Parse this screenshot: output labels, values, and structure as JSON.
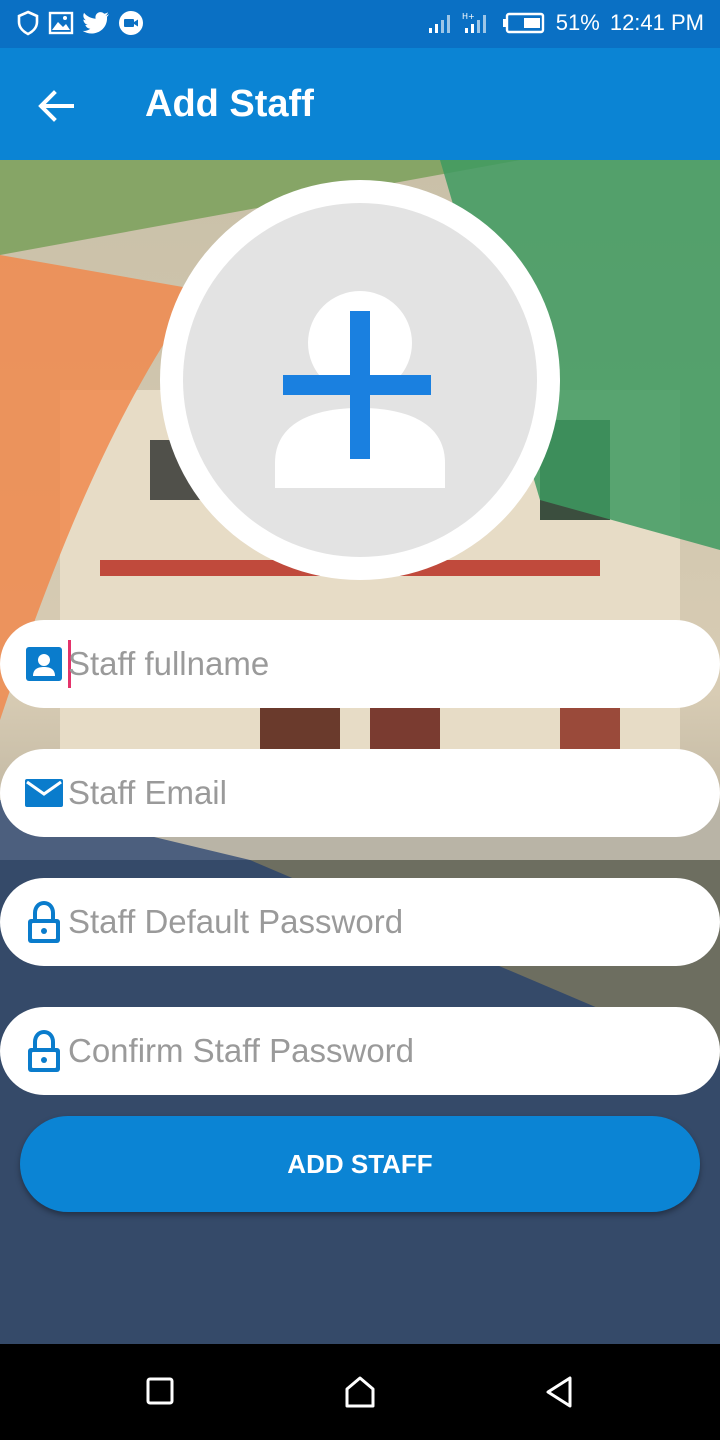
{
  "status_bar": {
    "battery": "51%",
    "time": "12:41 PM",
    "left_icons": [
      "shield-icon",
      "image-icon",
      "twitter-icon",
      "video-icon"
    ],
    "right_icons": [
      "signal-icon",
      "signal-ht-icon",
      "battery-icon"
    ]
  },
  "app_bar": {
    "title": "Add Staff",
    "back_icon": "arrow-left-icon"
  },
  "avatar": {
    "icon": "add-person-icon",
    "accent": "#1a80e0"
  },
  "form": {
    "fullname_placeholder": "Staff fullname",
    "email_placeholder": "Staff Email",
    "password_placeholder": "Staff Default Password",
    "confirm_placeholder": "Confirm Staff Password"
  },
  "submit": {
    "label": "ADD STAFF"
  },
  "nav_bar": {
    "items": [
      "recents-icon",
      "home-icon",
      "back-icon"
    ]
  },
  "colors": {
    "primary": "#0b84d4",
    "icon_blue": "#0a7ccc",
    "caret": "#e4336b"
  }
}
